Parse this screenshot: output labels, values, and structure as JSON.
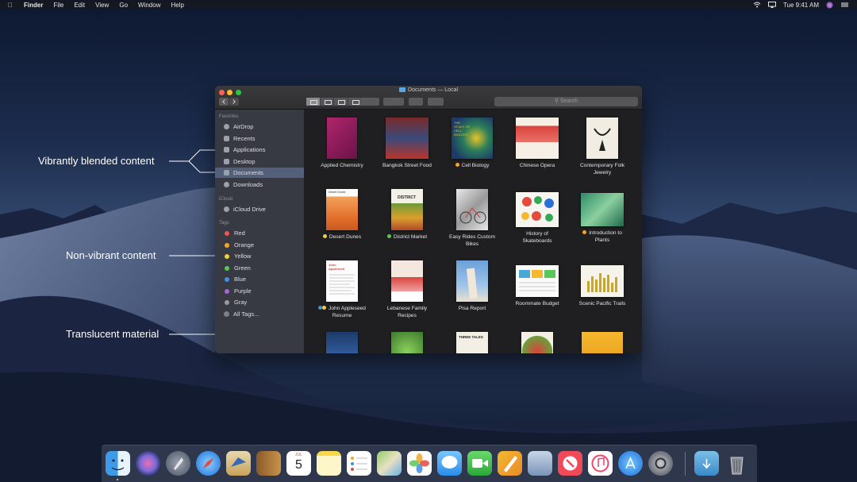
{
  "menubar": {
    "app_name": "Finder",
    "menus": [
      "File",
      "Edit",
      "View",
      "Go",
      "Window",
      "Help"
    ],
    "clock": "Tue 9:41 AM",
    "icons": [
      "wifi-icon",
      "airplay-icon",
      "siri-icon",
      "control-icon"
    ]
  },
  "annotations": {
    "vibrant": "Vibrantly blended content",
    "non_vibrant": "Non-vibrant content",
    "translucent": "Translucent material"
  },
  "window": {
    "title": "Documents — Local",
    "search_placeholder": "Search"
  },
  "sidebar": {
    "favorites_header": "Favorites",
    "favorites": [
      {
        "label": "AirDrop",
        "icon": "airdrop-icon"
      },
      {
        "label": "Recents",
        "icon": "recents-icon"
      },
      {
        "label": "Applications",
        "icon": "applications-icon"
      },
      {
        "label": "Desktop",
        "icon": "desktop-icon"
      },
      {
        "label": "Documents",
        "icon": "documents-icon"
      },
      {
        "label": "Downloads",
        "icon": "downloads-icon"
      }
    ],
    "icloud_header": "iCloud",
    "icloud": [
      {
        "label": "iCloud Drive",
        "icon": "cloud-icon"
      }
    ],
    "tags_header": "Tags",
    "tags": [
      {
        "label": "Red",
        "color": "#f2554e"
      },
      {
        "label": "Orange",
        "color": "#f5a623"
      },
      {
        "label": "Yellow",
        "color": "#f0cf3a"
      },
      {
        "label": "Green",
        "color": "#5bc65a"
      },
      {
        "label": "Blue",
        "color": "#3f8fe8"
      },
      {
        "label": "Purple",
        "color": "#a765d6"
      },
      {
        "label": "Gray",
        "color": "#9a9a9e"
      },
      {
        "label": "All Tags...",
        "color": "#7b7f88"
      }
    ]
  },
  "files": [
    {
      "line1": "Applied Chemistry",
      "line2": "",
      "tag": ""
    },
    {
      "line1": "Bangkok Street Food",
      "line2": "",
      "tag": ""
    },
    {
      "line1": "Cell Biology",
      "line2": "",
      "tag": "#f5a623"
    },
    {
      "line1": "Chinese Opera",
      "line2": "",
      "tag": ""
    },
    {
      "line1": "Contemporary Folk",
      "line2": "Jewelry",
      "tag": ""
    },
    {
      "line1": "Desert Dunes",
      "line2": "",
      "tag": "#f0cf3a"
    },
    {
      "line1": "District Market",
      "line2": "",
      "tag": "#5bc65a"
    },
    {
      "line1": "Easy Rides Custom",
      "line2": "Bikes",
      "tag": ""
    },
    {
      "line1": "History of",
      "line2": "Skateboards",
      "tag": ""
    },
    {
      "line1": "Introduction to",
      "line2": "Plants",
      "tag": "#f5a623"
    },
    {
      "line1": "John Appleseed",
      "line2": "Resume",
      "tag": "#f0cf3a"
    },
    {
      "line1": "Lebanese Family",
      "line2": "Recipes",
      "tag": ""
    },
    {
      "line1": "Pisa Report",
      "line2": "",
      "tag": ""
    },
    {
      "line1": "Roommate Budget",
      "line2": "",
      "tag": ""
    },
    {
      "line1": "Scenic Pacific Trails",
      "line2": "",
      "tag": ""
    }
  ],
  "thumb_texts": {
    "cell_biology": "THE STUDY OF CELL BIOLOGY",
    "desert": "Desert Dunes",
    "district": "DISTRICT",
    "resume": "John Appleseed",
    "three_tales": "THREE TALES",
    "calendar_month": "JUL",
    "calendar_day": "5"
  },
  "dock": [
    "finder-icon",
    "siri-icon",
    "launchpad-icon",
    "safari-icon",
    "mail-icon",
    "contacts-icon",
    "calendar-icon",
    "notes-icon",
    "reminders-icon",
    "maps-icon",
    "photos-icon",
    "messages-icon",
    "facetime-icon",
    "pages-icon",
    "preview-icon",
    "news-icon",
    "itunes-icon",
    "app-store-icon",
    "system-preferences-icon",
    "downloads-folder-icon",
    "trash-icon"
  ]
}
